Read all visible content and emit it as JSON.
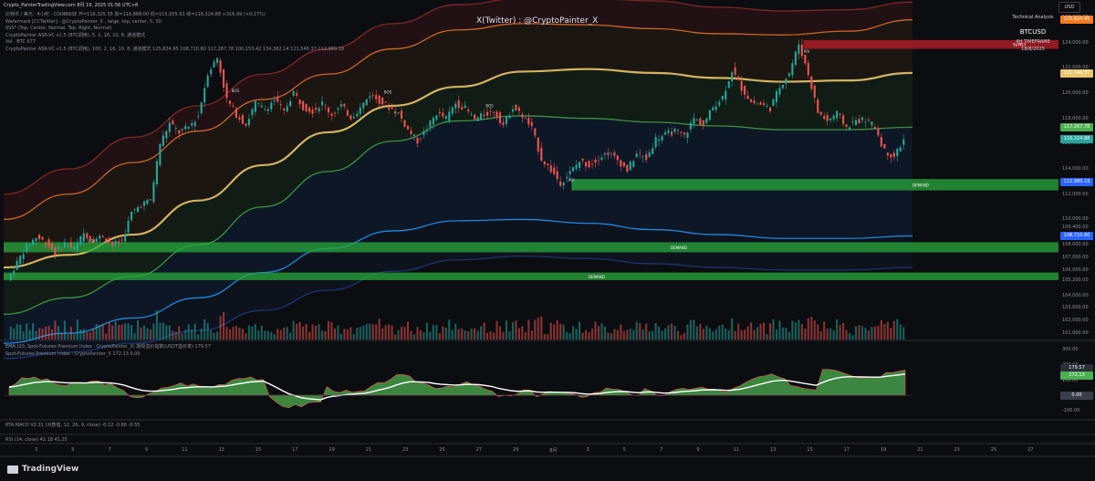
{
  "window_title": "Crypto_PainterTradingView.com 8月 19, 2025 01:56 UTC+8",
  "watermark": "X(Twitter) : @CryptoPainter_X",
  "currency_button": "USD",
  "info_panel": {
    "title": "Technical Analysis",
    "symbol": "BTCUSD",
    "timeframe": "4H TIMEFRAME",
    "date": "18/8/2025"
  },
  "legend_lines": [
    "比特币 / 美元 · 4小时 · COINBASE  开=116,325.35  高=116,888.00  低=115,955.91  收=116,324.88 +316.99 (+0.27%)",
    "Watermark [CCTwitter] : @CryptoPainter_X , large, top, center, 5, 30",
    "SSS* (Top, Center, Normal, Top, Right, Normal)",
    "CryptoPainter ASR-VC v1.5 (BTC调用), 5, 2, 16, 10, 8, 通道模式",
    "Vol · BTC  677",
    "CryptoPainter ASR-VC v1.5 (BTC调用), 100, 2, 16, 10, 8, 通道模式  125,824.95  108,710.60  117,267.78  100,153.42  134,382.14  121,546.37  112,989.19"
  ],
  "indicator_labels": {
    "ema": "EMA (20, Spot-Futures Premium Index · CryptoPainter_X) 期现溢价指数(USDT溢价率)  179.57",
    "premium": "Spot-Futures Premium Index · CryptoPainter_X  172.13  0.00",
    "macd": "RTA MACD V2.31 (对数值, 12, 26, 9, close)  -0.12  -0.66  -0.55",
    "rsi": "RSI (14, close)  42.18  41.25"
  },
  "zone_labels": {
    "supply": "SUPPLY",
    "demand_1": "DEMAND",
    "demand_2": "DEMAND",
    "demand_3": "DEMAND",
    "poi": "POI",
    "bos": "BOS"
  },
  "price_axis": [
    "126,000.00",
    "124,000.00",
    "122,000.00",
    "120,000.00",
    "118,000.00",
    "116,000.00",
    "114,000.00",
    "112,000.00",
    "110,000.00",
    "109,400.00",
    "108,000.00",
    "107,000.00",
    "106,000.00",
    "105,200.00",
    "104,000.00",
    "103,000.00",
    "102,000.00",
    "101,000.00"
  ],
  "price_badges": [
    {
      "text": "125,824.95",
      "price": 125824.95,
      "color": "#f47b20"
    },
    {
      "text": "121,546.37",
      "price": 121546.37,
      "color": "#e9c46a"
    },
    {
      "text": "117,267.78",
      "price": 117267.78,
      "color": "#4caf50"
    },
    {
      "text": "116,324.88",
      "price": 116324.88,
      "color": "#26a69a"
    },
    {
      "text": "112,989.19",
      "price": 112989.19,
      "color": "#2962ff"
    },
    {
      "text": "108,710.60",
      "price": 108710.6,
      "color": "#2962ff"
    }
  ],
  "osc_axis": [
    "300.00",
    "200.00",
    "100.00",
    "0.00",
    "-100.00"
  ],
  "osc_badges": [
    {
      "text": "179.57",
      "color": "#ffffff"
    },
    {
      "text": "172.13",
      "color": "#4caf50"
    },
    {
      "text": "0.00",
      "color": "#787b86"
    }
  ],
  "time_axis": [
    "3",
    "5",
    "7",
    "9",
    "11",
    "13",
    "15",
    "17",
    "19",
    "21",
    "23",
    "25",
    "27",
    "29",
    "8月",
    "3",
    "5",
    "7",
    "9",
    "11",
    "13",
    "15",
    "17",
    "19",
    "21",
    "23",
    "25",
    "27"
  ],
  "branding": "TradingView",
  "chart_data": {
    "type": "candlestick",
    "symbol": "BTCUSD",
    "interval": "4H",
    "exchange": "COINBASE",
    "ohlc_last": {
      "open": 116325.35,
      "high": 116888.0,
      "low": 115955.91,
      "close": 116324.88,
      "change": 316.99,
      "change_pct": 0.27
    },
    "y_range": [
      100500,
      126500
    ],
    "x_range_days_label": [
      "Jul 1",
      "Aug 27"
    ],
    "close_path": [
      {
        "t": 0,
        "c": 105200
      },
      {
        "t": 3,
        "c": 106600
      },
      {
        "t": 6,
        "c": 107900
      },
      {
        "t": 9,
        "c": 108600
      },
      {
        "t": 12,
        "c": 108200
      },
      {
        "t": 15,
        "c": 107400
      },
      {
        "t": 18,
        "c": 108100
      },
      {
        "t": 21,
        "c": 107700
      },
      {
        "t": 24,
        "c": 108900
      },
      {
        "t": 27,
        "c": 108400
      },
      {
        "t": 30,
        "c": 108700
      },
      {
        "t": 33,
        "c": 108000
      },
      {
        "t": 36,
        "c": 108300
      },
      {
        "t": 39,
        "c": 110500
      },
      {
        "t": 42,
        "c": 111200
      },
      {
        "t": 45,
        "c": 111500
      },
      {
        "t": 48,
        "c": 116000
      },
      {
        "t": 51,
        "c": 117600
      },
      {
        "t": 54,
        "c": 116900
      },
      {
        "t": 57,
        "c": 117300
      },
      {
        "t": 60,
        "c": 118200
      },
      {
        "t": 63,
        "c": 121600
      },
      {
        "t": 66,
        "c": 122800
      },
      {
        "t": 69,
        "c": 119500
      },
      {
        "t": 72,
        "c": 118300
      },
      {
        "t": 75,
        "c": 117500
      },
      {
        "t": 78,
        "c": 119200
      },
      {
        "t": 81,
        "c": 118700
      },
      {
        "t": 84,
        "c": 119500
      },
      {
        "t": 87,
        "c": 118500
      },
      {
        "t": 90,
        "c": 120100
      },
      {
        "t": 93,
        "c": 118900
      },
      {
        "t": 96,
        "c": 118600
      },
      {
        "t": 99,
        "c": 119200
      },
      {
        "t": 102,
        "c": 118300
      },
      {
        "t": 105,
        "c": 119000
      },
      {
        "t": 108,
        "c": 118100
      },
      {
        "t": 111,
        "c": 118800
      },
      {
        "t": 114,
        "c": 119900
      },
      {
        "t": 117,
        "c": 119400
      },
      {
        "t": 120,
        "c": 118900
      },
      {
        "t": 123,
        "c": 118400
      },
      {
        "t": 126,
        "c": 117100
      },
      {
        "t": 129,
        "c": 116200
      },
      {
        "t": 132,
        "c": 117200
      },
      {
        "t": 135,
        "c": 118400
      },
      {
        "t": 138,
        "c": 118000
      },
      {
        "t": 141,
        "c": 119200
      },
      {
        "t": 144,
        "c": 118800
      },
      {
        "t": 147,
        "c": 117900
      },
      {
        "t": 150,
        "c": 118300
      },
      {
        "t": 153,
        "c": 118600
      },
      {
        "t": 156,
        "c": 117500
      },
      {
        "t": 159,
        "c": 118900
      },
      {
        "t": 162,
        "c": 118200
      },
      {
        "t": 165,
        "c": 117200
      },
      {
        "t": 168,
        "c": 114800
      },
      {
        "t": 171,
        "c": 113900
      },
      {
        "t": 174,
        "c": 112900
      },
      {
        "t": 177,
        "c": 113700
      },
      {
        "t": 180,
        "c": 114600
      },
      {
        "t": 183,
        "c": 114300
      },
      {
        "t": 186,
        "c": 114900
      },
      {
        "t": 189,
        "c": 115300
      },
      {
        "t": 192,
        "c": 114700
      },
      {
        "t": 195,
        "c": 113900
      },
      {
        "t": 198,
        "c": 115200
      },
      {
        "t": 201,
        "c": 114800
      },
      {
        "t": 204,
        "c": 116400
      },
      {
        "t": 207,
        "c": 116700
      },
      {
        "t": 210,
        "c": 117000
      },
      {
        "t": 213,
        "c": 116600
      },
      {
        "t": 216,
        "c": 118000
      },
      {
        "t": 219,
        "c": 117500
      },
      {
        "t": 222,
        "c": 118900
      },
      {
        "t": 225,
        "c": 119700
      },
      {
        "t": 228,
        "c": 121800
      },
      {
        "t": 231,
        "c": 120400
      },
      {
        "t": 234,
        "c": 119300
      },
      {
        "t": 237,
        "c": 119100
      },
      {
        "t": 240,
        "c": 118800
      },
      {
        "t": 243,
        "c": 120500
      },
      {
        "t": 246,
        "c": 121600
      },
      {
        "t": 249,
        "c": 123900
      },
      {
        "t": 252,
        "c": 121500
      },
      {
        "t": 255,
        "c": 118500
      },
      {
        "t": 258,
        "c": 117800
      },
      {
        "t": 261,
        "c": 118400
      },
      {
        "t": 264,
        "c": 117300
      },
      {
        "t": 267,
        "c": 117800
      },
      {
        "t": 270,
        "c": 117900
      },
      {
        "t": 273,
        "c": 117300
      },
      {
        "t": 276,
        "c": 115400
      },
      {
        "t": 279,
        "c": 115000
      },
      {
        "t": 282,
        "c": 116300
      }
    ],
    "bands": [
      {
        "name": "outer upper",
        "color": "#8a2b2b",
        "values": [
          112000,
          114000,
          116500,
          119000,
          121500,
          123500,
          125500,
          127000,
          127500,
          127500,
          127300,
          126800,
          126500,
          126600,
          127200
        ]
      },
      {
        "name": "orange",
        "color": "#e0702a",
        "values": [
          110000,
          112000,
          114500,
          117000,
          119500,
          121500,
          123500,
          125000,
          125500,
          125400,
          125100,
          124700,
          124600,
          124900,
          125800
        ]
      },
      {
        "name": "yellow basis",
        "color": "#e9c46a",
        "values": [
          106200,
          107200,
          108800,
          111500,
          114300,
          116900,
          119000,
          120500,
          121700,
          121900,
          121600,
          121200,
          120900,
          121000,
          121600
        ]
      },
      {
        "name": "green",
        "color": "#43a047",
        "values": [
          102500,
          103800,
          105500,
          108000,
          111000,
          113800,
          116200,
          117800,
          118200,
          118000,
          117700,
          117400,
          117100,
          117100,
          117300
        ]
      },
      {
        "name": "blue",
        "color": "#2196f3",
        "values": [
          100200,
          101000,
          102200,
          103800,
          105800,
          107700,
          109100,
          109900,
          110000,
          109700,
          109200,
          108800,
          108500,
          108500,
          108700
        ]
      },
      {
        "name": "outer lower",
        "color": "#1e3a7a",
        "values": [
          99000,
          99500,
          100200,
          101200,
          102800,
          104400,
          105900,
          106800,
          107100,
          106900,
          106500,
          106200,
          106000,
          106000,
          106200
        ]
      }
    ],
    "zones": [
      {
        "type": "supply",
        "top": 124200,
        "bottom": 123500,
        "label": "SUPPLY"
      },
      {
        "type": "demand",
        "top": 113200,
        "bottom": 112300,
        "label": "DEMAND"
      },
      {
        "type": "demand",
        "top": 108200,
        "bottom": 107400,
        "label": "DEMAND"
      },
      {
        "type": "demand",
        "top": 105800,
        "bottom": 105200,
        "label": "DEMAND"
      }
    ],
    "oscillator": {
      "name": "Spot-Futures Premium Index",
      "y_range": [
        -150,
        320
      ],
      "ema_last": 179.57,
      "premium_last": 172.13
    }
  }
}
